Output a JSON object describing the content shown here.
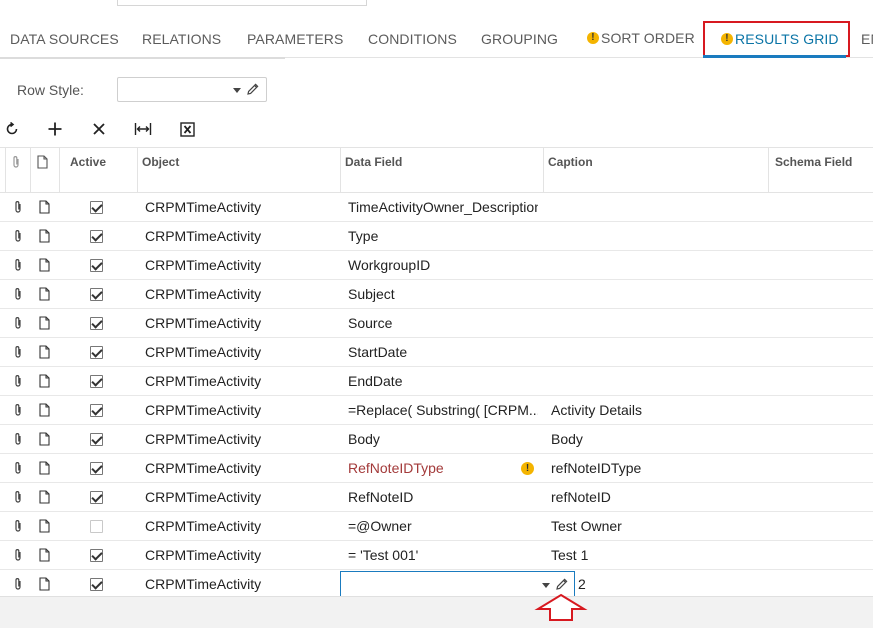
{
  "tabs": [
    {
      "label": "DATA SOURCES",
      "warning": false
    },
    {
      "label": "RELATIONS",
      "warning": false
    },
    {
      "label": "PARAMETERS",
      "warning": false
    },
    {
      "label": "CONDITIONS",
      "warning": false
    },
    {
      "label": "GROUPING",
      "warning": false
    },
    {
      "label": "SORT ORDER",
      "warning": true
    },
    {
      "label": "RESULTS GRID",
      "warning": true,
      "active": true
    },
    {
      "label": "EN",
      "warning": false
    }
  ],
  "warning_glyph": "!",
  "row_style": {
    "label": "Row Style:",
    "value": ""
  },
  "toolbar": {
    "icons": [
      "refresh-icon",
      "add-icon",
      "delete-icon",
      "fit-columns-icon",
      "export-excel-icon"
    ]
  },
  "grid": {
    "headers": {
      "active": "Active",
      "object": "Object",
      "data_field": "Data Field",
      "caption": "Caption",
      "schema_field": "Schema Field"
    },
    "rows": [
      {
        "active": true,
        "object": "CRPMTimeActivity",
        "data_field": "TimeActivityOwner_Description",
        "caption": ""
      },
      {
        "active": true,
        "object": "CRPMTimeActivity",
        "data_field": "Type",
        "caption": ""
      },
      {
        "active": true,
        "object": "CRPMTimeActivity",
        "data_field": "WorkgroupID",
        "caption": ""
      },
      {
        "active": true,
        "object": "CRPMTimeActivity",
        "data_field": "Subject",
        "caption": ""
      },
      {
        "active": true,
        "object": "CRPMTimeActivity",
        "data_field": "Source",
        "caption": ""
      },
      {
        "active": true,
        "object": "CRPMTimeActivity",
        "data_field": "StartDate",
        "caption": ""
      },
      {
        "active": true,
        "object": "CRPMTimeActivity",
        "data_field": "EndDate",
        "caption": ""
      },
      {
        "active": true,
        "object": "CRPMTimeActivity",
        "data_field": "=Replace( Substring( [CRPM...",
        "caption": "Activity Details"
      },
      {
        "active": true,
        "object": "CRPMTimeActivity",
        "data_field": "Body",
        "caption": "Body"
      },
      {
        "active": true,
        "object": "CRPMTimeActivity",
        "data_field": "RefNoteIDType",
        "caption": "refNoteIDType",
        "warning": true
      },
      {
        "active": true,
        "object": "CRPMTimeActivity",
        "data_field": "RefNoteID",
        "caption": "refNoteID"
      },
      {
        "active": false,
        "object": "CRPMTimeActivity",
        "data_field": "=@Owner",
        "caption": "Test Owner"
      },
      {
        "active": true,
        "object": "CRPMTimeActivity",
        "data_field": "= 'Test 001'",
        "caption": "Test 1"
      },
      {
        "active": true,
        "object": "CRPMTimeActivity",
        "data_field": "",
        "caption": "2",
        "editing": true
      }
    ]
  },
  "colors": {
    "active_tab": "#0a74a6",
    "highlight_box": "#d71920",
    "warning": "#f4b400",
    "warning_text": "#a33a3a",
    "edit_border": "#1a7bbf"
  }
}
